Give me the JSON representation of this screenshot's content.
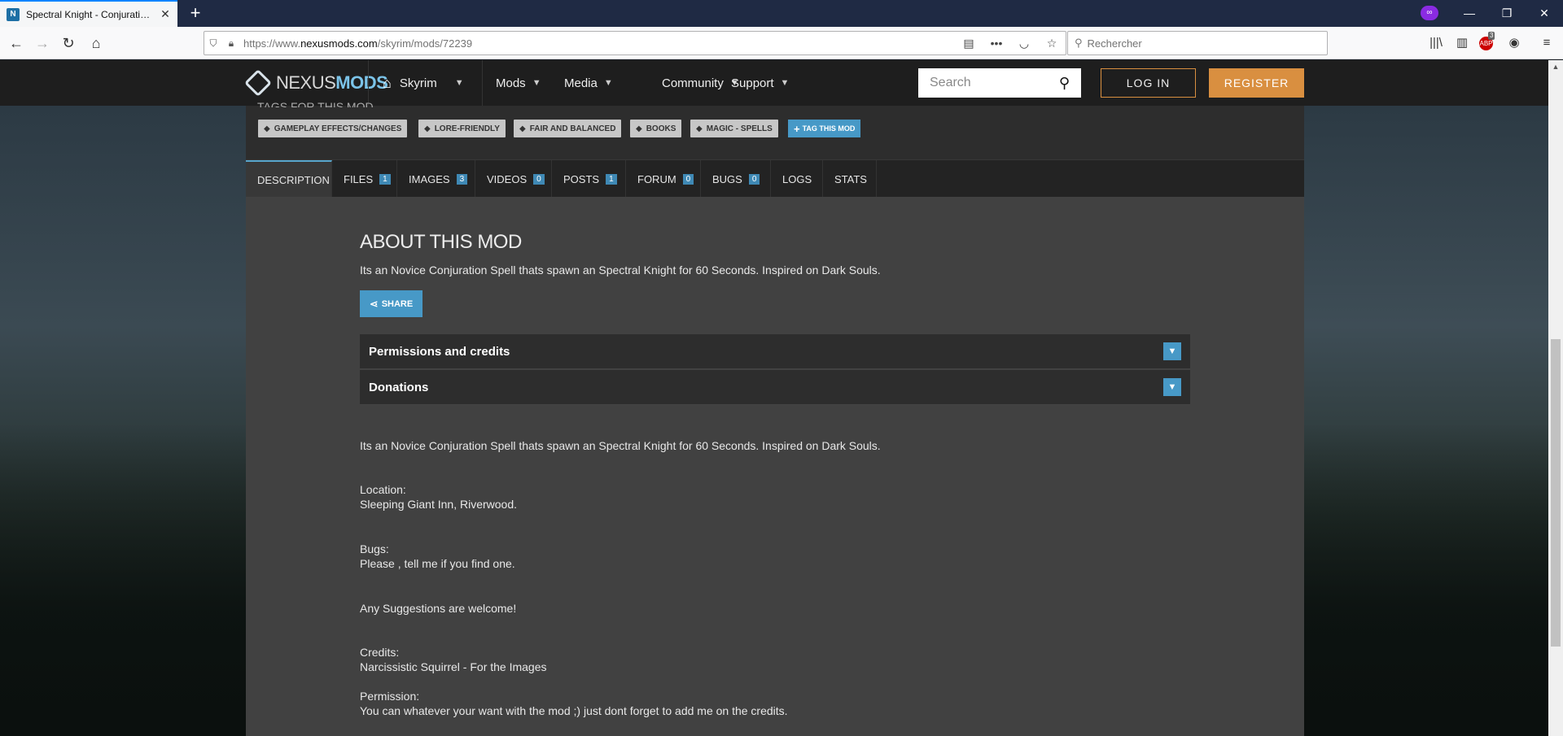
{
  "browser": {
    "tab_title": "Spectral Knight - Conjuration S",
    "tab_favicon": "N",
    "new_tab": "+",
    "url_host_prefix": "https://www.",
    "url_host": "nexusmods.com",
    "url_path": "/skyrim/mods/72239",
    "search_placeholder": "Rechercher",
    "abp_label": "ABP",
    "abp_badge": "3",
    "private_mask": "∞"
  },
  "site": {
    "logo_part1": "NEXUS",
    "logo_part2": "MODS",
    "nav": [
      {
        "label": "Skyrim"
      },
      {
        "label": "Mods"
      },
      {
        "label": "Media"
      },
      {
        "label": "Community"
      },
      {
        "label": "Support"
      }
    ],
    "search_placeholder": "Search",
    "login": "LOG IN",
    "register": "REGISTER"
  },
  "tags": {
    "title": "TAGS FOR THIS MOD",
    "items": [
      "GAMEPLAY EFFECTS/CHANGES",
      "LORE-FRIENDLY",
      "FAIR AND BALANCED",
      "BOOKS",
      "MAGIC - SPELLS"
    ],
    "add_label": "TAG THIS MOD"
  },
  "mod_tabs": [
    {
      "label": "DESCRIPTION",
      "count": null,
      "active": true
    },
    {
      "label": "FILES",
      "count": "1"
    },
    {
      "label": "IMAGES",
      "count": "3"
    },
    {
      "label": "VIDEOS",
      "count": "0"
    },
    {
      "label": "POSTS",
      "count": "1"
    },
    {
      "label": "FORUM",
      "count": "0"
    },
    {
      "label": "BUGS",
      "count": "0"
    },
    {
      "label": "LOGS",
      "count": null
    },
    {
      "label": "STATS",
      "count": null
    }
  ],
  "about": {
    "title": "ABOUT THIS MOD",
    "summary": "Its an Novice Conjuration Spell thats spawn an Spectral Knight for 60 Seconds. Inspired on Dark Souls.",
    "share": "SHARE",
    "accordions": [
      "Permissions and credits",
      "Donations"
    ]
  },
  "description": {
    "intro": "Its an Novice Conjuration Spell thats spawn an Spectral Knight for 60 Seconds. Inspired on Dark Souls.",
    "location_label": "Location:",
    "location_value": "Sleeping Giant Inn, Riverwood.",
    "bugs_label": "Bugs:",
    "bugs_value": "Please , tell me if you find one.",
    "suggestions": "Any Suggestions are welcome!",
    "credits_label": "Credits:",
    "credits_value": "Narcissistic Squirrel - For the Images",
    "permission_label": "Permission:",
    "permission_value": "You can whatever your want with the mod ;) just dont forget to add me on the credits."
  },
  "colors": {
    "accent_blue": "#4799c7",
    "register_orange": "#d98f40",
    "panel_dark": "#2d2d2d"
  }
}
